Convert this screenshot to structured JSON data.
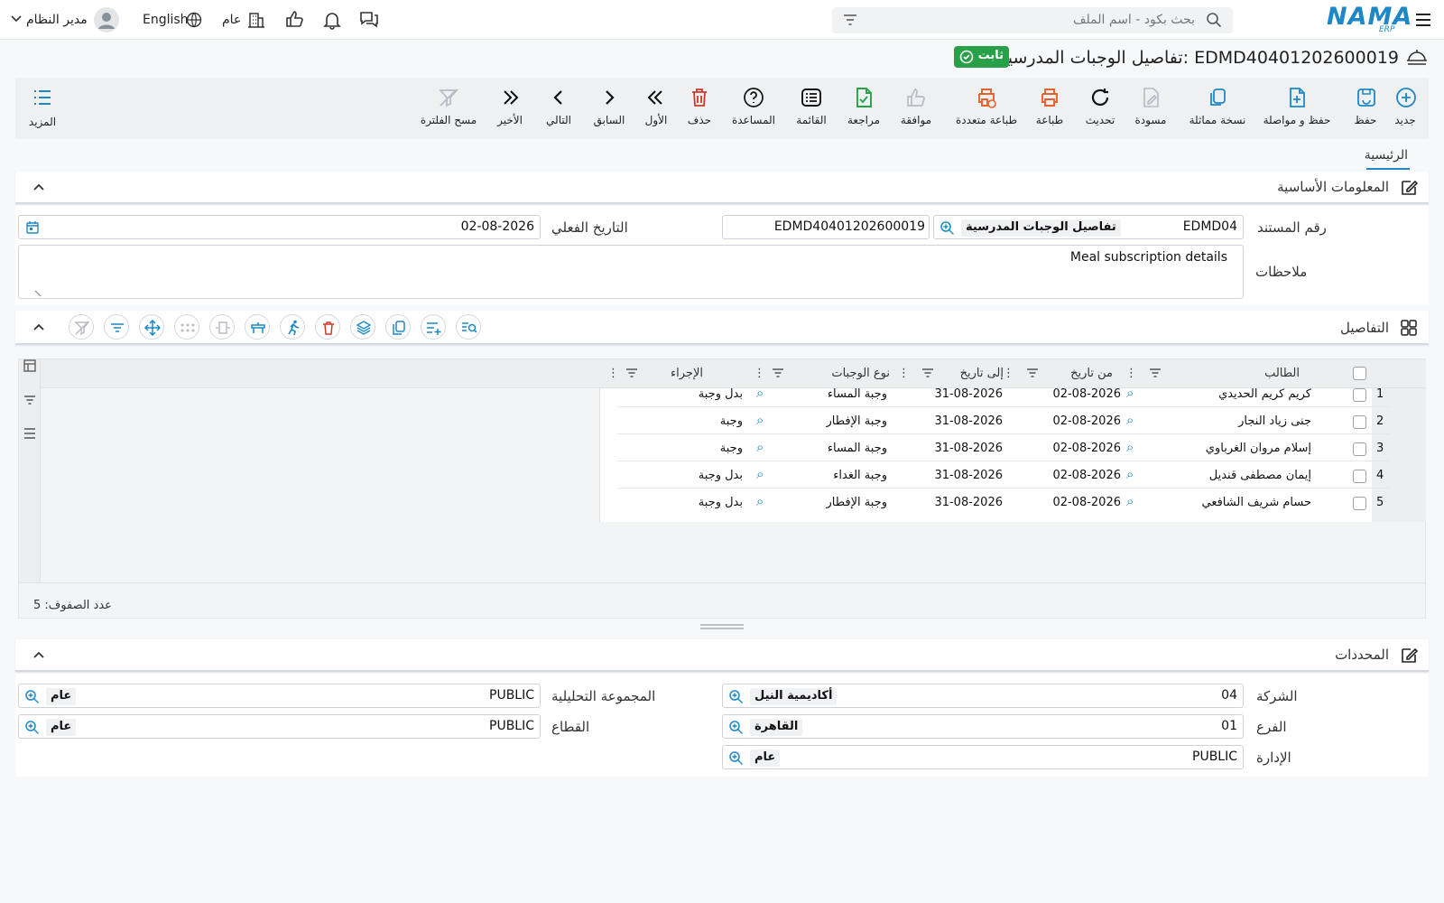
{
  "topbar": {
    "brand": "NAMA",
    "brand_sub": "ERP",
    "search_placeholder": "بحث بكود - اسم الملف",
    "user_name": "مدير النظام",
    "language": "English",
    "scope": "عام"
  },
  "header": {
    "title": "تفاصيل الوجبات المدرسية: EDMD40401202600019",
    "status_badge": "ثابت"
  },
  "toolbar": {
    "items": [
      {
        "label": "جديد",
        "icon": "plus-circle-icon"
      },
      {
        "label": "حفظ",
        "icon": "save-icon"
      },
      {
        "label": "حفظ و مواصلة",
        "icon": "save-continue-icon"
      },
      {
        "label": "نسخة مماثلة",
        "icon": "copy-icon"
      },
      {
        "label": "مسودة",
        "icon": "draft-icon"
      },
      {
        "label": "تحديث",
        "icon": "refresh-icon"
      },
      {
        "label": "طباعة",
        "icon": "print-icon"
      },
      {
        "label": "طباعة متعددة",
        "icon": "multi-print-icon"
      },
      {
        "label": "موافقة",
        "icon": "thumbs-up-icon"
      },
      {
        "label": "مراجعة",
        "icon": "review-icon"
      },
      {
        "label": "القائمة",
        "icon": "list-icon"
      },
      {
        "label": "المساعدة",
        "icon": "help-icon"
      },
      {
        "label": "حذف",
        "icon": "trash-icon"
      },
      {
        "label": "الأول",
        "icon": "first-icon"
      },
      {
        "label": "السابق",
        "icon": "previous-icon"
      },
      {
        "label": "التالي",
        "icon": "next-icon"
      },
      {
        "label": "الأخير",
        "icon": "last-icon"
      },
      {
        "label": "مسح الفلترة",
        "icon": "clear-filter-icon"
      }
    ],
    "more_label": "المزيد"
  },
  "tabs": {
    "main": "الرئيسية"
  },
  "basic_info": {
    "title": "المعلومات الأساسية",
    "doc_number_label": "رقم المستند",
    "doc_code": "EDMD04",
    "doc_type": "تفاصيل الوجبات المدرسية",
    "doc_number": "EDMD40401202600019",
    "actual_date_label": "التاريخ الفعلي",
    "actual_date": "02-08-2026",
    "notes_label": "ملاحظات",
    "notes": "Meal subscription details"
  },
  "details": {
    "title": "التفاصيل",
    "columns": {
      "student": "الطالب",
      "from_date": "من تاريخ",
      "to_date": "إلى تاريخ",
      "meal_type": "نوع الوجبات",
      "action": "الإجراء"
    },
    "rows": [
      {
        "num": "1",
        "student": "كريم كريم الحديدي",
        "from": "02-08-2026",
        "to": "31-08-2026",
        "meal": "وجبة المساء",
        "action": "بدل وجبة"
      },
      {
        "num": "2",
        "student": "جنى زياد النجار",
        "from": "02-08-2026",
        "to": "31-08-2026",
        "meal": "وجبة الإفطار",
        "action": "وجبة"
      },
      {
        "num": "3",
        "student": "إسلام مروان الغرباوي",
        "from": "02-08-2026",
        "to": "31-08-2026",
        "meal": "وجبة المساء",
        "action": "وجبة"
      },
      {
        "num": "4",
        "student": "إيمان مصطفى قنديل",
        "from": "02-08-2026",
        "to": "31-08-2026",
        "meal": "وجبة الغداء",
        "action": "بدل وجبة"
      },
      {
        "num": "5",
        "student": "حسام شريف الشافعي",
        "from": "02-08-2026",
        "to": "31-08-2026",
        "meal": "وجبة الإفطار",
        "action": "بدل وجبة"
      }
    ],
    "row_count_label": "عدد الصفوف: 5"
  },
  "dimensions": {
    "title": "المحددات",
    "company_label": "الشركة",
    "company_code": "04",
    "company_name": "أكاديمية النيل",
    "branch_label": "الفرع",
    "branch_code": "01",
    "branch_name": "القاهرة",
    "department_label": "الإدارة",
    "department_code": "PUBLIC",
    "department_name": "عام",
    "analytic_label": "المجموعة التحليلية",
    "analytic_code": "PUBLIC",
    "analytic_name": "عام",
    "sector_label": "القطاع",
    "sector_code": "PUBLIC",
    "sector_name": "عام"
  },
  "colors": {
    "accent": "#1e88c7",
    "success": "#27a047",
    "danger": "#d0392b",
    "print": "#e8602c"
  }
}
